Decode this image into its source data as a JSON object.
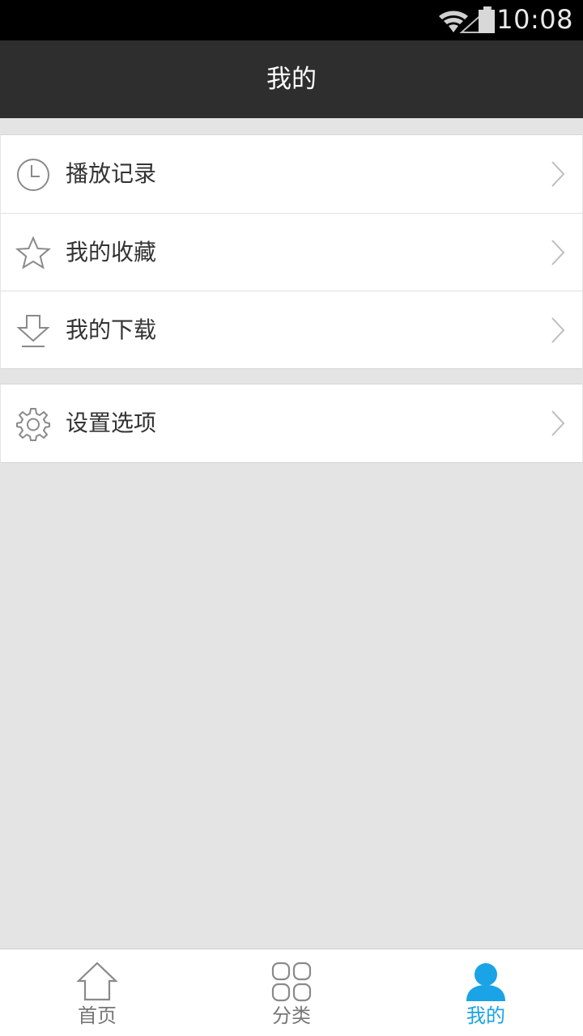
{
  "status_bar": {
    "time": "10:08",
    "icons": [
      "wifi-icon",
      "signal-icon",
      "battery-icon"
    ]
  },
  "header": {
    "title": "我的"
  },
  "menu_groups": [
    {
      "items": [
        {
          "label": "播放记录",
          "icon": "clock-icon"
        },
        {
          "label": "我的收藏",
          "icon": "star-icon"
        },
        {
          "label": "我的下载",
          "icon": "download-icon"
        }
      ]
    },
    {
      "items": [
        {
          "label": "设置选项",
          "icon": "gear-icon"
        }
      ]
    }
  ],
  "bottom_nav": {
    "tabs": [
      {
        "label": "首页",
        "icon": "home-icon",
        "active": false
      },
      {
        "label": "分类",
        "icon": "grid-icon",
        "active": false
      },
      {
        "label": "我的",
        "icon": "user-icon",
        "active": true
      }
    ]
  },
  "colors": {
    "accent": "#1aa3e6",
    "header_bg": "#2e2e2e",
    "page_bg": "#e4e4e4",
    "icon_gray": "#8a8a8a"
  }
}
